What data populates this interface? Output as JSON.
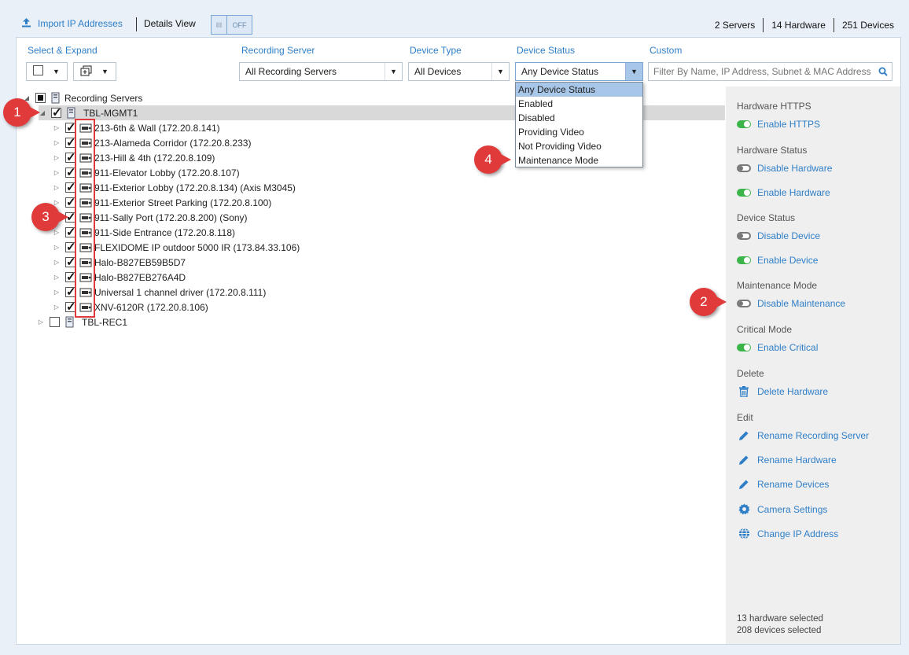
{
  "toolbar": {
    "import_label": "Import IP Addresses",
    "details_view_label": "Details View",
    "toggle_state": "OFF",
    "toggle_left": "III",
    "counts": {
      "servers": "2 Servers",
      "hardware": "14 Hardware",
      "devices": "251 Devices"
    }
  },
  "filters": {
    "select_expand_label": "Select & Expand",
    "recording_server_label": "Recording Server",
    "recording_server_value": "All Recording Servers",
    "device_type_label": "Device Type",
    "device_type_value": "All Devices",
    "device_status_label": "Device Status",
    "device_status_value": "Any Device Status",
    "custom_label": "Custom",
    "custom_placeholder": "Filter By Name, IP Address, Subnet & MAC Address"
  },
  "device_status_options": [
    "Any Device Status",
    "Enabled",
    "Disabled",
    "Providing Video",
    "Not Providing Video",
    "Maintenance Mode"
  ],
  "tree": {
    "root": "Recording Servers",
    "servers": [
      {
        "name": "TBL-MGMT1",
        "devices": [
          "213-6th & Wall (172.20.8.141)",
          "213-Alameda Corridor (172.20.8.233)",
          "213-Hill & 4th (172.20.8.109)",
          "911-Elevator Lobby (172.20.8.107)",
          "911-Exterior Lobby (172.20.8.134) (Axis M3045)",
          "911-Exterior Street Parking (172.20.8.100)",
          "911-Sally Port (172.20.8.200) (Sony)",
          "911-Side Entrance (172.20.8.118)",
          "FLEXIDOME IP outdoor 5000 IR (173.84.33.106)",
          "Halo-B827EB59B5D7",
          "Halo-B827EB276A4D",
          "Universal 1 channel driver (172.20.8.111)",
          "XNV-6120R (172.20.8.106)"
        ]
      },
      {
        "name": "TBL-REC1",
        "devices": []
      }
    ]
  },
  "side": {
    "hardware_https": "Hardware HTTPS",
    "enable_https": "Enable HTTPS",
    "hardware_status": "Hardware Status",
    "disable_hardware": "Disable Hardware",
    "enable_hardware": "Enable Hardware",
    "device_status": "Device Status",
    "disable_device": "Disable Device",
    "enable_device": "Enable Device",
    "maintenance_mode": "Maintenance Mode",
    "disable_maintenance": "Disable Maintenance",
    "critical_mode": "Critical Mode",
    "enable_critical": "Enable Critical",
    "delete": "Delete",
    "delete_hardware": "Delete Hardware",
    "edit": "Edit",
    "rename_server": "Rename Recording Server",
    "rename_hardware": "Rename Hardware",
    "rename_devices": "Rename Devices",
    "camera_settings": "Camera Settings",
    "change_ip": "Change IP Address",
    "hardware_selected": "13 hardware selected",
    "devices_selected": "208 devices selected"
  },
  "callouts": [
    "1",
    "2",
    "3",
    "4"
  ],
  "colors": {
    "accent": "#2f7fc8",
    "callout": "#e03a3a",
    "switch_on": "#3bb54a"
  }
}
